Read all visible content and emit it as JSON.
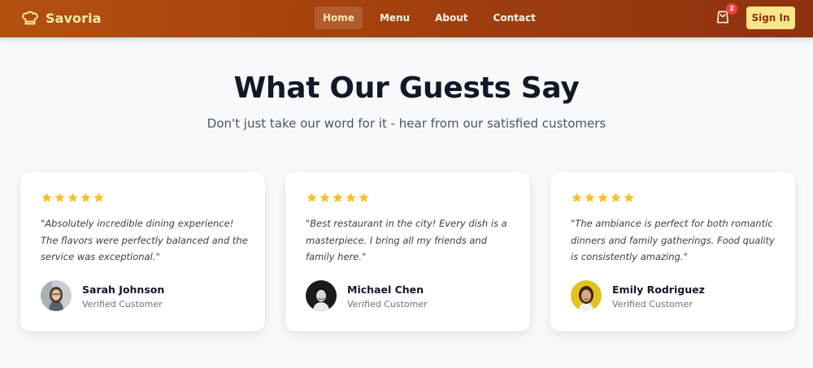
{
  "navbar": {
    "brand": "Savoria",
    "brand_icon": "chef-hat-icon",
    "links": [
      {
        "label": "Home",
        "active": true
      },
      {
        "label": "Menu",
        "active": false
      },
      {
        "label": "About",
        "active": false
      },
      {
        "label": "Contact",
        "active": false
      }
    ],
    "cart_icon": "shopping-bag-icon",
    "cart_count": "2",
    "signin_label": "Sign In"
  },
  "testimonials": {
    "title": "What Our Guests Say",
    "subtitle": "Don't just take our word for it - hear from our satisfied customers",
    "star_color": "#fbbf24",
    "items": [
      {
        "rating": 5,
        "quote": "\"Absolutely incredible dining experience! The flavors were perfectly balanced and the service was exceptional.\"",
        "name": "Sarah Johnson",
        "role": "Verified Customer"
      },
      {
        "rating": 5,
        "quote": "\"Best restaurant in the city! Every dish is a masterpiece. I bring all my friends and family here.\"",
        "name": "Michael Chen",
        "role": "Verified Customer"
      },
      {
        "rating": 5,
        "quote": "\"The ambiance is perfect for both romantic dinners and family gatherings. Food quality is consistently amazing.\"",
        "name": "Emily Rodriguez",
        "role": "Verified Customer"
      }
    ]
  },
  "colors": {
    "navbar_start": "#b4500f",
    "navbar_end": "#8e3210",
    "brand_text": "#fde9a8",
    "signin_bg": "#fde68a",
    "badge": "#ef4444"
  }
}
